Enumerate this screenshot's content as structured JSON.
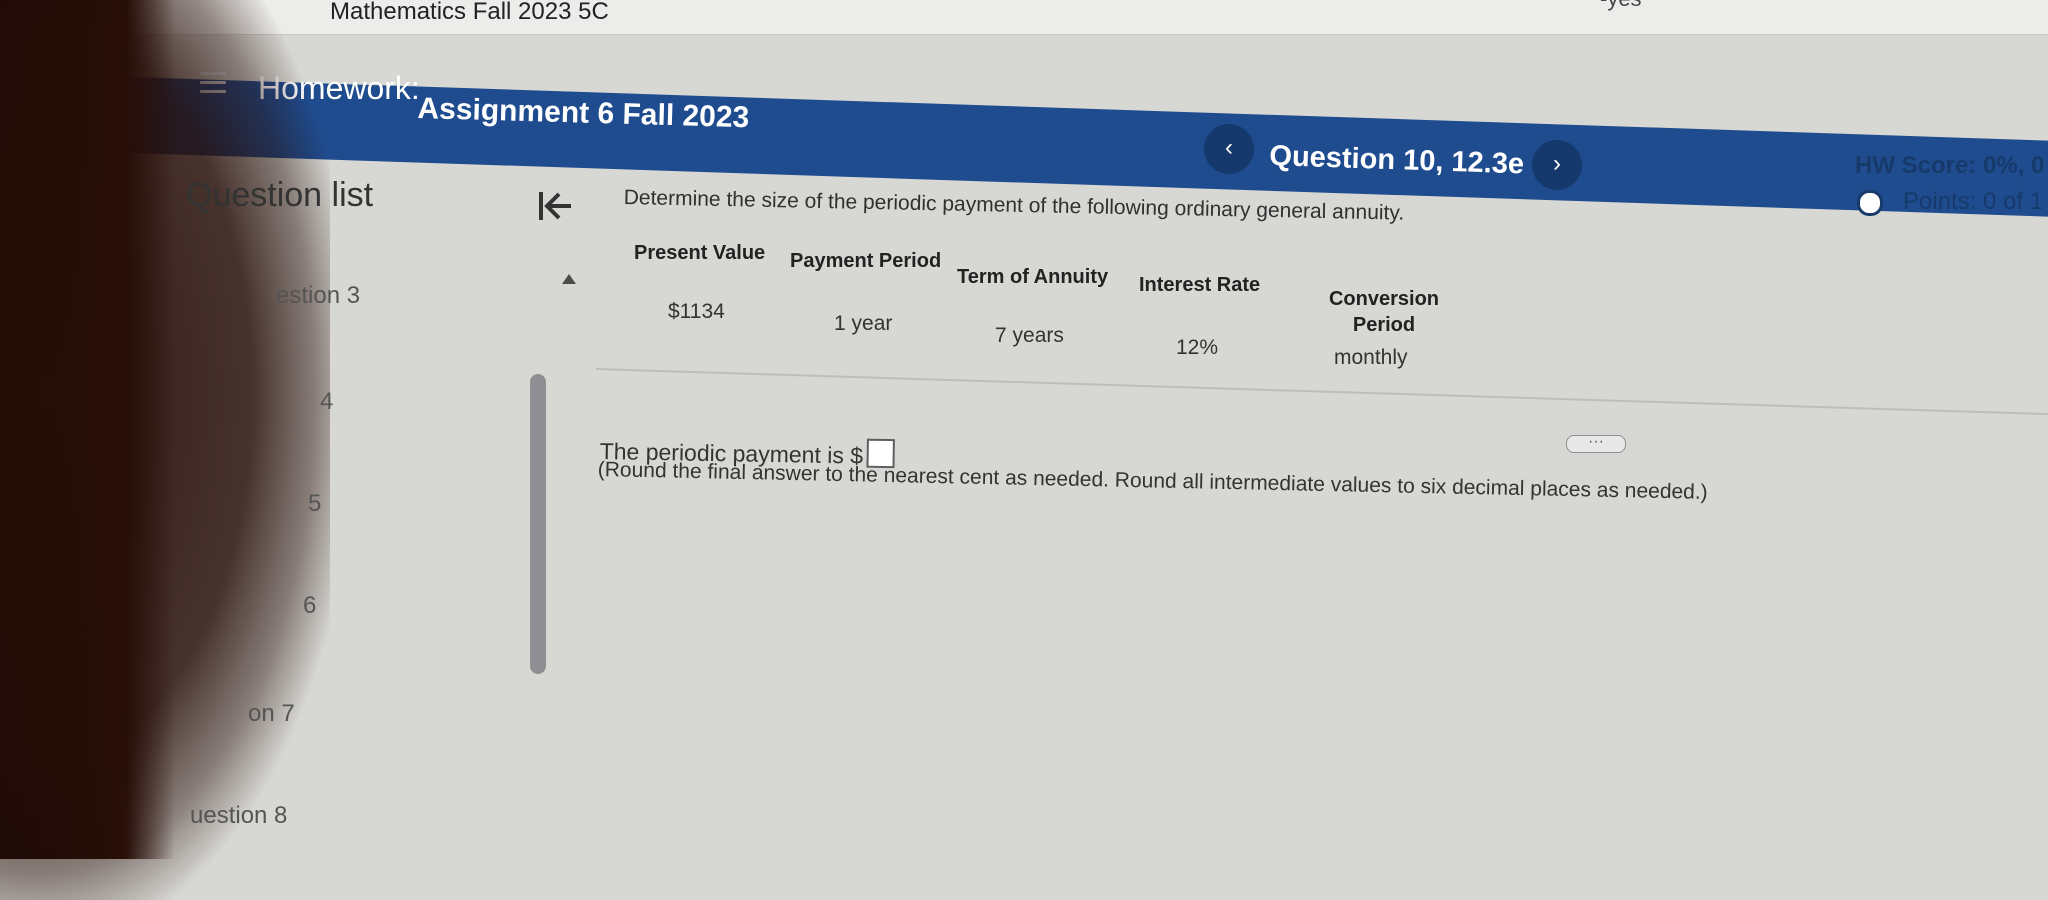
{
  "browser": {
    "tab_title": "Mathematics Fall 2023 5C",
    "extra_text": "-yes"
  },
  "header": {
    "menu_icon": "menu-icon",
    "prefix": "Homework:",
    "assignment": "Assignment 6 Fall 2023",
    "question": "Question 10, 12.3e",
    "prev": "‹",
    "next": "›"
  },
  "score": {
    "hw_score": "HW Score: 0%, 0",
    "points": "Points: 0 of 1"
  },
  "sidebar": {
    "title": "Question list",
    "items": [
      "estion 3",
      "4",
      "5",
      "6",
      "on 7",
      "uestion 8"
    ]
  },
  "question": {
    "prompt": "Determine the size of the periodic payment of the following ordinary general annuity.",
    "table": {
      "headers": [
        "Present Value",
        "Payment Period",
        "Term of Annuity",
        "Interest Rate",
        "Conversion Period"
      ],
      "row": [
        "$1134",
        "1 year",
        "7 years",
        "12%",
        "monthly"
      ]
    },
    "answer_label": "The periodic payment is $",
    "note": "(Round the final answer to the nearest cent as needed. Round all intermediate values to six decimal places as needed.)"
  }
}
